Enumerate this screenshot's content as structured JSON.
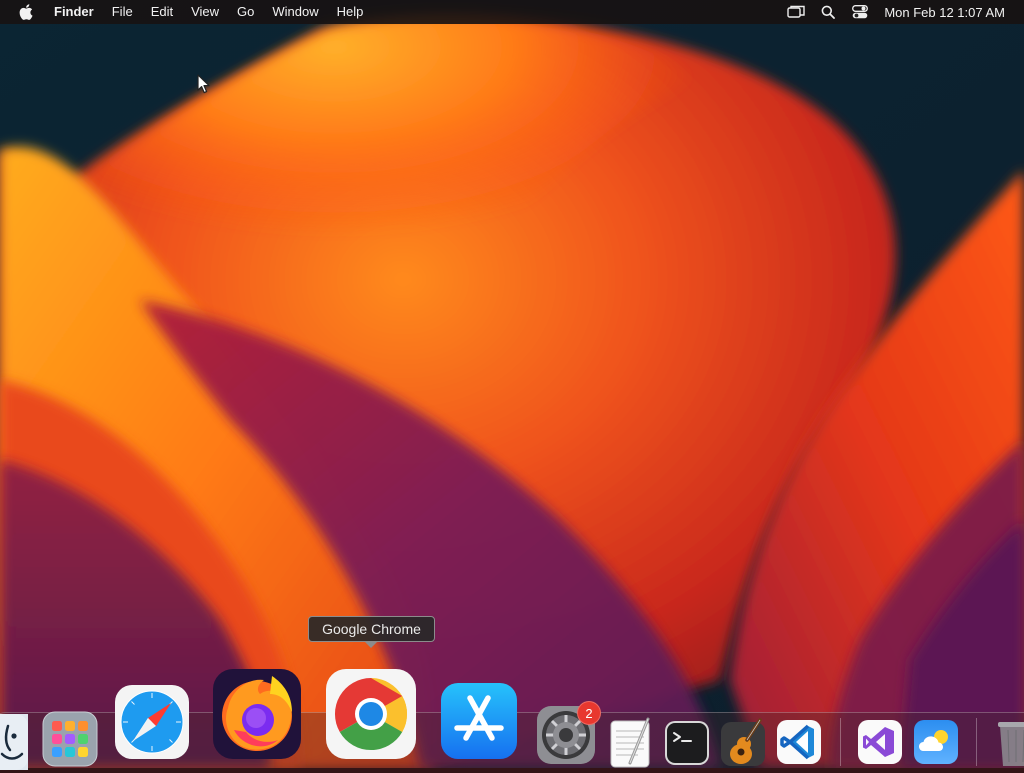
{
  "menubar": {
    "app_name": "Finder",
    "menus": [
      "File",
      "Edit",
      "View",
      "Go",
      "Window",
      "Help"
    ],
    "clock": "Mon Feb 12  1:07 AM"
  },
  "tooltip": {
    "text": "Google Chrome"
  },
  "dock": {
    "apps": [
      "Finder",
      "Launchpad",
      "Safari",
      "Firefox",
      "Google Chrome",
      "App Store",
      "System Settings",
      "TextEdit",
      "Terminal",
      "GarageBand",
      "Visual Studio Code",
      "Visual Studio",
      "Weather",
      "Trash"
    ],
    "system_settings_badge": "2"
  },
  "colors": {
    "menubar_bg": "#181212",
    "tooltip_border": "#8c8c8c",
    "badge": "#e8382f"
  }
}
